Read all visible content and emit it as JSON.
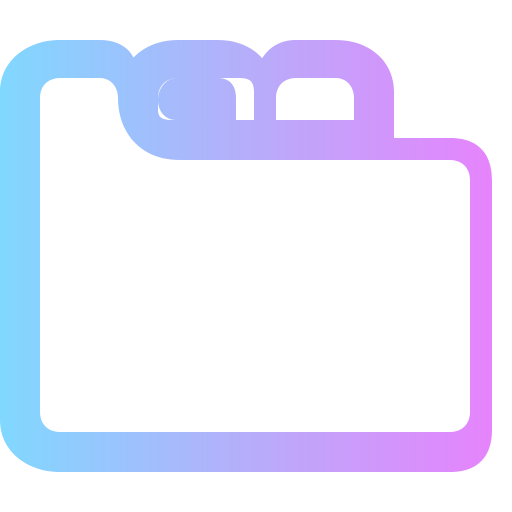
{
  "icon": {
    "name": "folder-with-tabs-icon",
    "gradient": {
      "start_color": "#80D8FF",
      "mid_color": "#B8ACFA",
      "end_color": "#EA80FC"
    }
  }
}
